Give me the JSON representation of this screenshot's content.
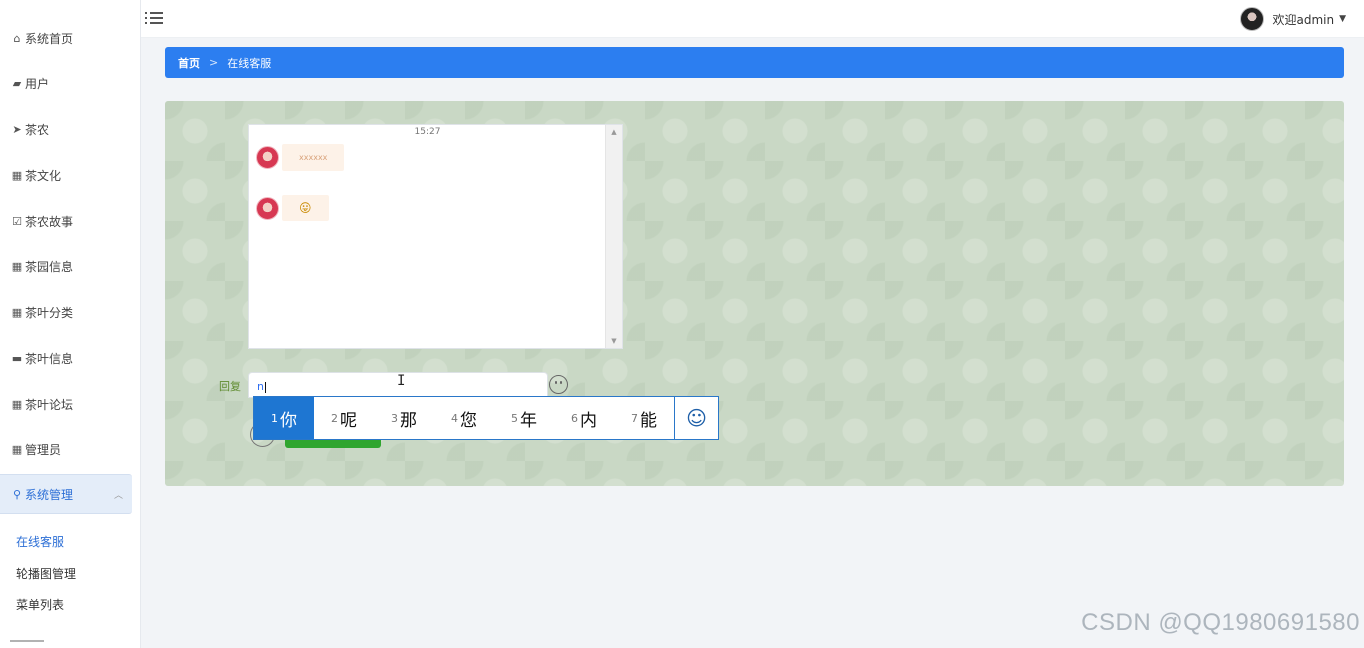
{
  "sidebar": {
    "items": [
      {
        "label": "系统首页",
        "icon": "home-icon",
        "glyph": "⌂"
      },
      {
        "label": "用户",
        "icon": "briefcase-icon",
        "glyph": "▰"
      },
      {
        "label": "茶农",
        "icon": "send-icon",
        "glyph": "➤"
      },
      {
        "label": "茶文化",
        "icon": "grid-icon",
        "glyph": "▦"
      },
      {
        "label": "茶农故事",
        "icon": "checkbox-icon",
        "glyph": "☑"
      },
      {
        "label": "茶园信息",
        "icon": "grid-icon",
        "glyph": "▦"
      },
      {
        "label": "茶叶分类",
        "icon": "grid-icon",
        "glyph": "▦"
      },
      {
        "label": "茶叶信息",
        "icon": "monitor-icon",
        "glyph": "▬"
      },
      {
        "label": "茶叶论坛",
        "icon": "grid-icon",
        "glyph": "▦"
      },
      {
        "label": "管理员",
        "icon": "grid-icon",
        "glyph": "▦"
      }
    ],
    "active": {
      "label": "系统管理",
      "icon": "pin-icon",
      "glyph": "⚲",
      "chevron": "︿"
    },
    "subitems": [
      "在线客服",
      "轮播图管理",
      "菜单列表"
    ]
  },
  "topbar": {
    "welcome": "欢迎admin",
    "caret": "▼"
  },
  "breadcrumb": {
    "home": "首页",
    "separator": ">",
    "current": "在线客服"
  },
  "chat": {
    "time": "15:27",
    "messages": [
      {
        "text": "xxxxxx"
      },
      {
        "text": "😛"
      }
    ],
    "scroll_up": "▲",
    "scroll_down": "▼"
  },
  "reply": {
    "label": "回复",
    "value": "n",
    "ibeam": "I"
  },
  "ime": {
    "candidates": [
      {
        "num": "1",
        "char": "你"
      },
      {
        "num": "2",
        "char": "呢"
      },
      {
        "num": "3",
        "char": "那"
      },
      {
        "num": "4",
        "char": "您"
      },
      {
        "num": "5",
        "char": "年"
      },
      {
        "num": "6",
        "char": "内"
      },
      {
        "num": "7",
        "char": "能"
      }
    ],
    "emoji": "☺"
  },
  "watermark": "CSDN @QQ1980691580",
  "colors": {
    "accent": "#2c7ef0",
    "panel_bg": "#c9d8c5",
    "send_button": "#2fa52f"
  }
}
